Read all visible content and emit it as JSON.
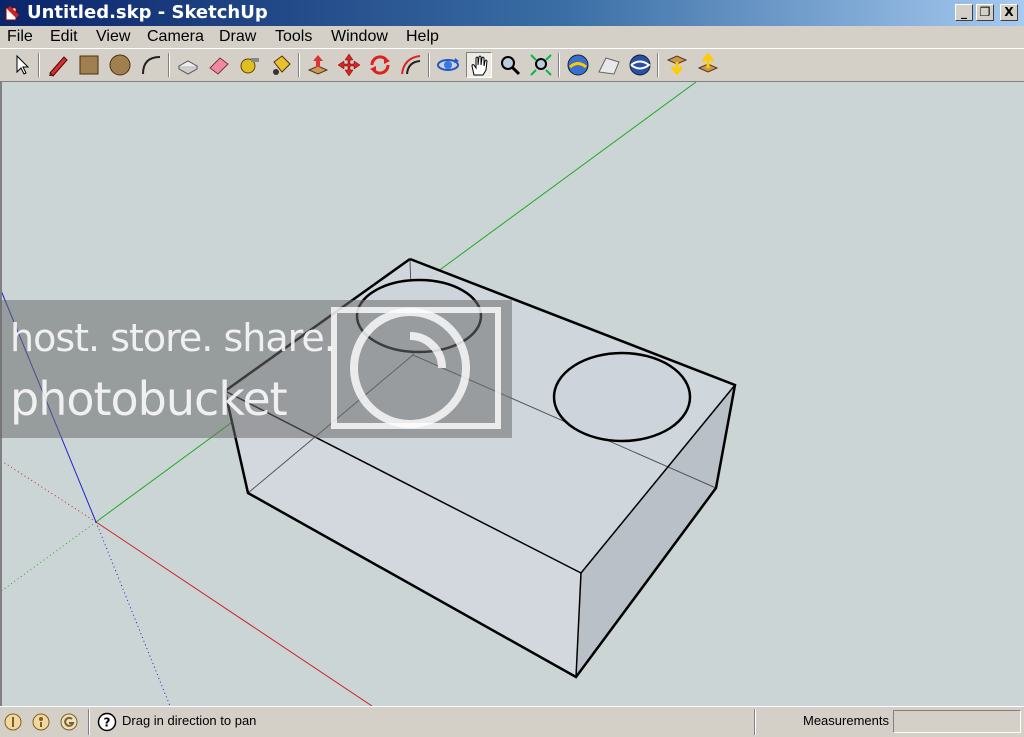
{
  "window": {
    "title": "Untitled.skp - SketchUp",
    "minimize": "_",
    "restore": "❐",
    "close": "X"
  },
  "menu": [
    "File",
    "Edit",
    "View",
    "Camera",
    "Draw",
    "Tools",
    "Window",
    "Help"
  ],
  "toolbar": [
    {
      "icon": "select-arrow-icon"
    },
    {
      "icon": "pencil-icon"
    },
    {
      "icon": "rectangle-icon"
    },
    {
      "icon": "circle-icon"
    },
    {
      "icon": "arc-icon"
    },
    {
      "icon": "make-component-icon"
    },
    {
      "icon": "eraser-icon"
    },
    {
      "icon": "tape-measure-icon"
    },
    {
      "icon": "paint-bucket-icon"
    },
    {
      "icon": "push-pull-icon"
    },
    {
      "icon": "move-icon"
    },
    {
      "icon": "rotate-icon"
    },
    {
      "icon": "offset-icon"
    },
    {
      "icon": "orbit-icon"
    },
    {
      "icon": "pan-icon"
    },
    {
      "icon": "zoom-icon"
    },
    {
      "icon": "zoom-extents-icon"
    },
    {
      "icon": "google-earth-view-icon"
    },
    {
      "icon": "google-earth-terrain-icon"
    },
    {
      "icon": "google-earth-place-icon"
    },
    {
      "icon": "get-models-icon"
    },
    {
      "icon": "share-model-icon"
    }
  ],
  "watermark": {
    "line1": "host. store. share.",
    "line2": "photobucket"
  },
  "status": {
    "hint": "Drag in direction to pan",
    "measurements_label": "Measurements",
    "measurements_value": ""
  },
  "colors": {
    "viewport_bg": "#cbd5d5",
    "axis_red": "#cc2222",
    "axis_green": "#22aa22",
    "axis_blue": "#2222cc"
  }
}
